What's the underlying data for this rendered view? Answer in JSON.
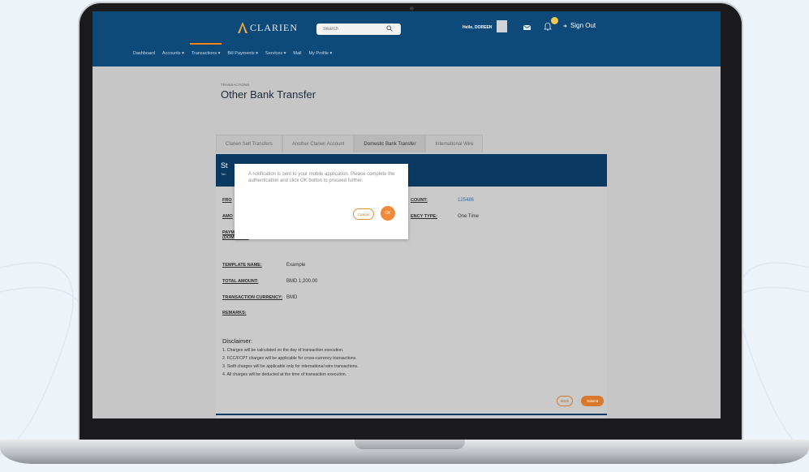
{
  "header": {
    "brand": "CLARIEN",
    "search_placeholder": "Search",
    "greeting": "Hello, DOREEN",
    "signout_label": "Sign Out"
  },
  "nav": {
    "items": [
      {
        "label": "Dashboard"
      },
      {
        "label": "Accounts ▾"
      },
      {
        "label": "Transactions ▾"
      },
      {
        "label": "Bill Payments ▾"
      },
      {
        "label": "Services ▾"
      },
      {
        "label": "Mail"
      },
      {
        "label": "My Profile ▾"
      }
    ]
  },
  "page": {
    "breadcrumb": "TRANSACTIONS",
    "title": "Other Bank Transfer"
  },
  "tabs": [
    {
      "label": "Clarien Self Transfers",
      "active": false
    },
    {
      "label": "Another Clarien Account",
      "active": false
    },
    {
      "label": "Domestic Bank Transfer",
      "active": true
    },
    {
      "label": "International Wire",
      "active": false
    }
  ],
  "form": {
    "heading_fragment": "St",
    "subheading_fragment": "Tan",
    "from_label_fragment": "FRO",
    "amount_label_fragment": "AMO",
    "payment_label_fragment": "PAYM",
    "payment_label_fragment2": "(DOMESTIC)",
    "to_account_label": "COUNT:",
    "to_account_value": "125486",
    "frequency_label": "ENCY TYPE:",
    "frequency_value": "One Time",
    "template_name_label": "TEMPLATE NAME:",
    "template_name_value": "Example",
    "total_amount_label": "TOTAL AMOUNT:",
    "total_amount_value": "BMD 1,200.00",
    "currency_label": "TRANSACTION CURRENCY:",
    "currency_value": "BMD",
    "remarks_label": "REMARKS:"
  },
  "disclaimer": {
    "title": "Disclaimer:",
    "lines": [
      "1. Charges will be calculated on the day of transaction execution.",
      "2. FCC/FCPT charges will be applicable for cross-currency transactions.",
      "3. Swift charges will be applicable only for international wire transactions.",
      "4. All charges will be deducted at the time of transaction execution."
    ]
  },
  "actions": {
    "back_label": "Back",
    "submit_label": "Submit"
  },
  "modal": {
    "message": "A notification is sent to your mobile application. Please complete the authentication and click OK button to proceed further.",
    "cancel_label": "Cancel",
    "ok_label": "OK"
  },
  "colors": {
    "brand_navy": "#0d4a7a",
    "accent_orange": "#ef8a3a",
    "notification_badge": "#f2c94c"
  }
}
